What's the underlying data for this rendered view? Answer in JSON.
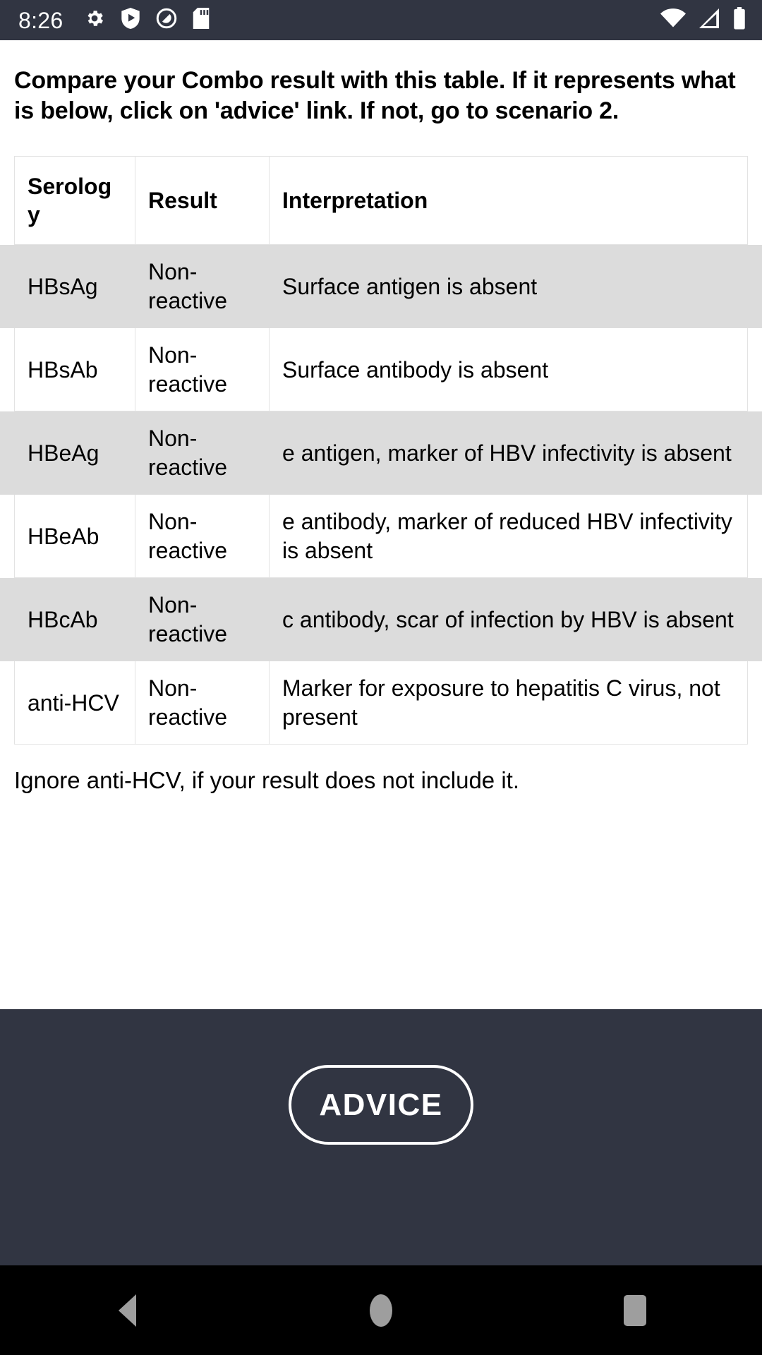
{
  "statusbar": {
    "clock": "8:26",
    "left_icons": [
      "gear-icon",
      "shield-play-icon",
      "clone-slash-icon",
      "sd-card-icon"
    ],
    "right_icons": [
      "wifi-icon",
      "cell-signal-icon",
      "battery-icon"
    ],
    "background": "#313542"
  },
  "main": {
    "intro": "Compare your Combo result with this table. If it represents what is below, click on 'advice' link. If not, go to scenario 2.",
    "note": "Ignore anti-HCV, if your result does not include it.",
    "table": {
      "headers": [
        "Serology",
        "Result",
        "Interpretation"
      ],
      "rows": [
        {
          "serology": "HBsAg",
          "result": "Non-reactive",
          "interpretation": "Surface antigen is absent"
        },
        {
          "serology": "HBsAb",
          "result": "Non-reactive",
          "interpretation": "Surface antibody is absent"
        },
        {
          "serology": "HBeAg",
          "result": "Non-reactive",
          "interpretation": "e antigen, marker of HBV infectivity is absent"
        },
        {
          "serology": "HBeAb",
          "result": "Non-reactive",
          "interpretation": "e antibody, marker of reduced HBV infectivity is absent"
        },
        {
          "serology": "HBcAb",
          "result": "Non-reactive",
          "interpretation": "c antibody, scar of infection by HBV is absent"
        },
        {
          "serology": "anti-HCV",
          "result": "Non-reactive",
          "interpretation": "Marker for exposure to hepatitis C virus, not present"
        }
      ],
      "shaded_row_color": "#dcdcdc",
      "border_color": "#e3e3e3"
    }
  },
  "footer": {
    "advice_label": "ADVICE",
    "background": "#313542"
  },
  "navbar": {
    "background": "#000000",
    "buttons": [
      "back-nav-button",
      "home-nav-button",
      "recents-nav-button"
    ]
  }
}
